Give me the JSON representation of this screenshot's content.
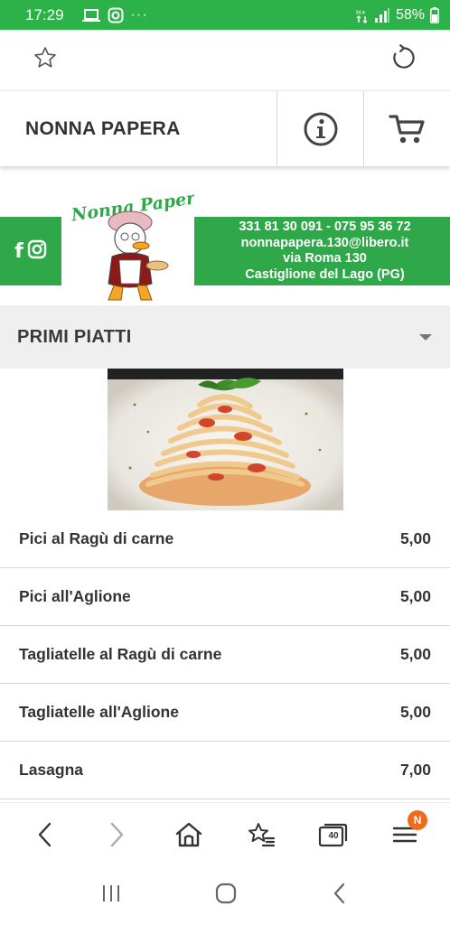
{
  "status_bar": {
    "time": "17:29",
    "battery": "58%"
  },
  "header": {
    "title": "NONNA PAPERA"
  },
  "banner": {
    "logo_text": "Nonna Papera",
    "phone": "331 81 30 091 - 075 95 36 72",
    "email": "nonnapapera.130@libero.it",
    "address": "via Roma 130",
    "city": "Castiglione del Lago (PG)"
  },
  "section": {
    "title": "PRIMI PIATTI"
  },
  "menu_items": [
    {
      "name": "Pici al Ragù di carne",
      "price": "5,00"
    },
    {
      "name": "Pici all'Aglione",
      "price": "5,00"
    },
    {
      "name": "Tagliatelle al Ragù di carne",
      "price": "5,00"
    },
    {
      "name": "Tagliatelle all'Aglione",
      "price": "5,00"
    },
    {
      "name": "Lasagna",
      "price": "7,00"
    }
  ],
  "browser_nav": {
    "tab_count": "40",
    "menu_badge": "N"
  },
  "colors": {
    "brand_green": "#2fa84a",
    "status_green": "#2db24a",
    "badge_orange": "#f26b1d"
  },
  "icons": {
    "favorite": "star-icon",
    "reload": "reload-icon",
    "info": "info-icon",
    "cart": "cart-icon",
    "facebook": "facebook-icon",
    "instagram": "instagram-icon"
  }
}
